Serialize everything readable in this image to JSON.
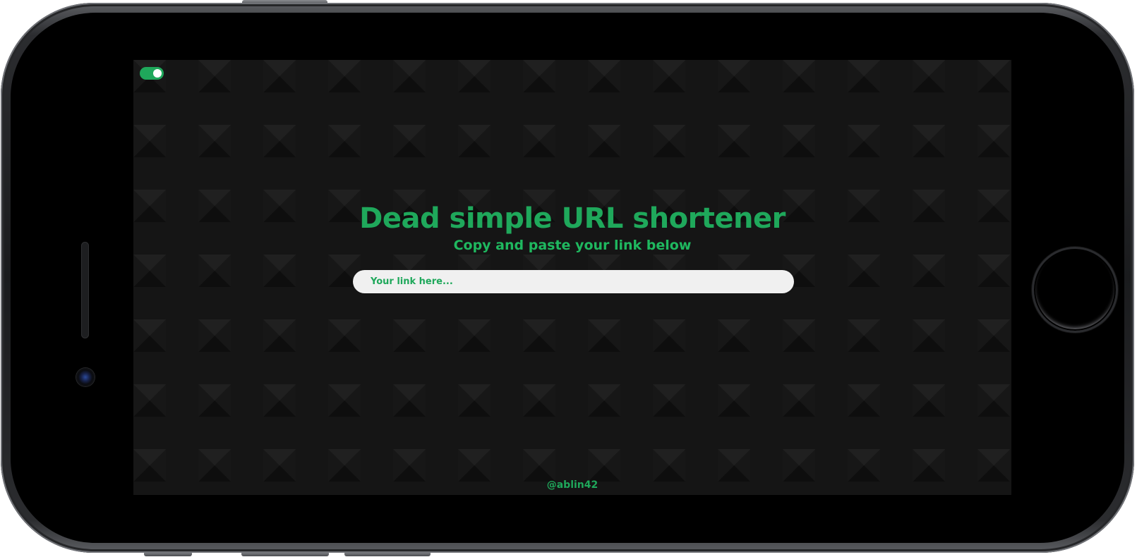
{
  "app": {
    "title": "Dead simple URL shortener",
    "subtitle": "Copy and paste your link below"
  },
  "theme_toggle": {
    "state": "on",
    "color": "#1fa85b"
  },
  "link_input": {
    "value": "",
    "placeholder": "Your link here..."
  },
  "footer": {
    "credit": "@ablin42"
  },
  "colors": {
    "accent": "#1fa85b",
    "screen_background": "#151515",
    "input_background": "#f0f0f0"
  },
  "device": {
    "icons": [
      "speaker-icon",
      "camera-icon",
      "home-button"
    ]
  }
}
